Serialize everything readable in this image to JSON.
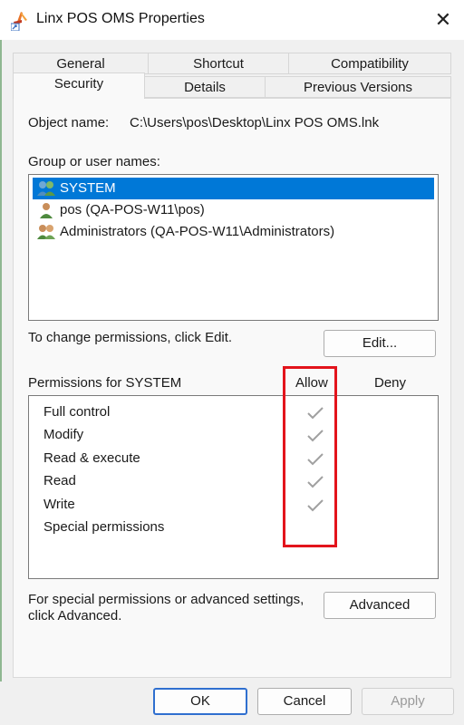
{
  "window": {
    "title": "Linx POS OMS Properties",
    "close_glyph": "✕",
    "app_icon": "shortcut-app-icon"
  },
  "tabs": {
    "row1": [
      "General",
      "Shortcut",
      "Compatibility"
    ],
    "row2": [
      "Security",
      "Details",
      "Previous Versions"
    ],
    "active": "Security"
  },
  "security": {
    "object_name_label": "Object name:",
    "object_name_value": "C:\\Users\\pos\\Desktop\\Linx POS OMS.lnk",
    "group_label": "Group or user names:",
    "users": [
      {
        "name": "SYSTEM",
        "selected": true,
        "icon": "group-users-icon"
      },
      {
        "name": "pos (QA-POS-W11\\pos)",
        "selected": false,
        "icon": "user-icon"
      },
      {
        "name": "Administrators (QA-POS-W11\\Administrators)",
        "selected": false,
        "icon": "group-users-icon"
      }
    ],
    "change_hint": "To change permissions, click Edit.",
    "edit_button": "Edit...",
    "permissions_label": "Permissions for SYSTEM",
    "allow_header": "Allow",
    "deny_header": "Deny",
    "permissions": [
      {
        "name": "Full control",
        "allow": true,
        "deny": false
      },
      {
        "name": "Modify",
        "allow": true,
        "deny": false
      },
      {
        "name": "Read & execute",
        "allow": true,
        "deny": false
      },
      {
        "name": "Read",
        "allow": true,
        "deny": false
      },
      {
        "name": "Write",
        "allow": true,
        "deny": false
      },
      {
        "name": "Special permissions",
        "allow": false,
        "deny": false
      }
    ],
    "advanced_hint_line1": "For special permissions or advanced settings,",
    "advanced_hint_line2": "click Advanced.",
    "advanced_button": "Advanced"
  },
  "footer": {
    "ok": "OK",
    "cancel": "Cancel",
    "apply": "Apply"
  },
  "colors": {
    "selection": "#0078d7",
    "highlight_box": "#e3141c",
    "check": "#a0a0a0"
  }
}
